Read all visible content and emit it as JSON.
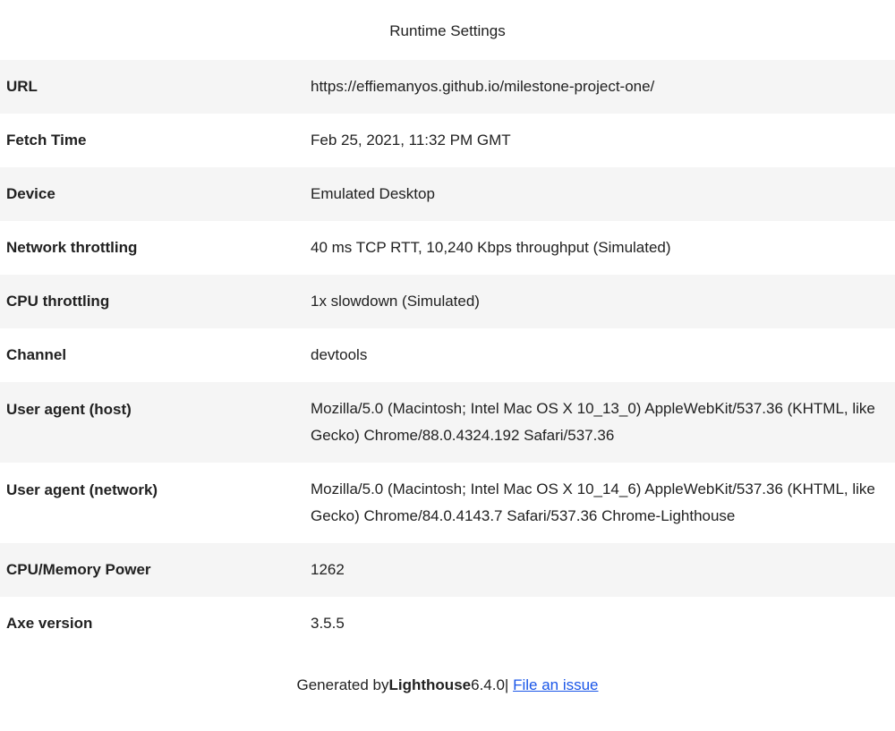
{
  "title": "Runtime Settings",
  "rows": [
    {
      "label": "URL",
      "value": "https://effiemanyos.github.io/milestone-project-one/"
    },
    {
      "label": "Fetch Time",
      "value": "Feb 25, 2021, 11:32 PM GMT"
    },
    {
      "label": "Device",
      "value": "Emulated Desktop"
    },
    {
      "label": "Network throttling",
      "value": "40 ms TCP RTT, 10,240 Kbps throughput (Simulated)"
    },
    {
      "label": "CPU throttling",
      "value": "1x slowdown (Simulated)"
    },
    {
      "label": "Channel",
      "value": "devtools"
    },
    {
      "label": "User agent (host)",
      "value": "Mozilla/5.0 (Macintosh; Intel Mac OS X 10_13_0) AppleWebKit/537.36 (KHTML, like Gecko) Chrome/88.0.4324.192 Safari/537.36"
    },
    {
      "label": "User agent (network)",
      "value": "Mozilla/5.0 (Macintosh; Intel Mac OS X 10_14_6) AppleWebKit/537.36 (KHTML, like Gecko) Chrome/84.0.4143.7 Safari/537.36 Chrome-Lighthouse"
    },
    {
      "label": "CPU/Memory Power",
      "value": "1262"
    },
    {
      "label": "Axe version",
      "value": "3.5.5"
    }
  ],
  "footer": {
    "prefix": "Generated by ",
    "product": "Lighthouse",
    "version": " 6.4.0 ",
    "separator": "|",
    "link_label": "File an issue"
  }
}
